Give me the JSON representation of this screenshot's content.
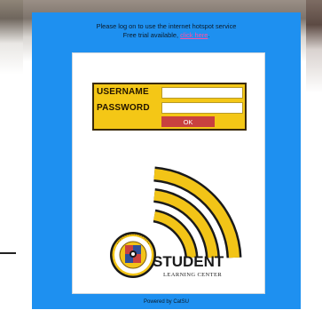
{
  "portal": {
    "notice_line1": "Please log on to use the internet hotspot service",
    "notice_line2_prefix": "Free trial available,",
    "notice_link": "click here",
    "notice_suffix": "."
  },
  "login": {
    "username_label": "USERNAME",
    "password_label": "PASSWORD",
    "username_value": "",
    "password_value": "",
    "ok_label": "OK"
  },
  "logo": {
    "name": "STUDENT",
    "subtitle": "LEARNING CENTER",
    "seal_text": "CATANDUANES STATE UNIVERSITY",
    "icon": "wifi-signal-icon"
  },
  "footer": {
    "powered_by": "Powered by CatSU"
  },
  "colors": {
    "portal_blue": "#1e90f0",
    "login_yellow": "#f4c716",
    "ok_red": "#c9413f",
    "wifi_yellow": "#f2c417",
    "link_pink": "#ff4fa3"
  }
}
